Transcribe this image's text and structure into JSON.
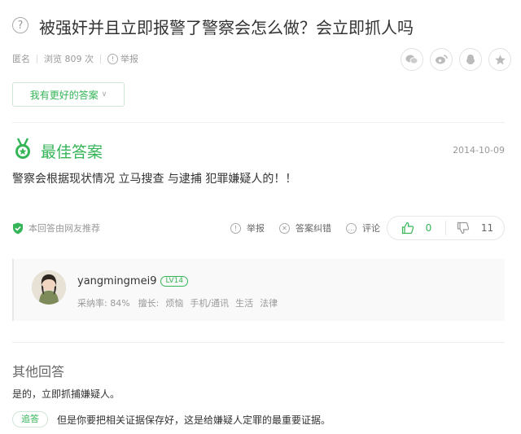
{
  "question": {
    "icon": "question-circle-icon",
    "title": "被强奸并且立即报警了警察会怎么做？会立即抓人吗",
    "meta": {
      "author": "匿名",
      "views": "浏览 809 次",
      "report": "举报"
    },
    "share_icons": [
      "wechat-icon",
      "weibo-icon",
      "qq-icon",
      "favorite-icon"
    ],
    "better_answer_button": "我有更好的答案"
  },
  "best_answer": {
    "label": "最佳答案",
    "date": "2014-10-09",
    "content": "警察会根据现状情况  立马搜查 与逮捕 犯罪嫌疑人的！！",
    "recommend_text": "本回答由网友推荐",
    "actions": {
      "report": "举报",
      "correct": "答案纠错",
      "comment": "评论"
    },
    "votes": {
      "up": "0",
      "down": "11"
    }
  },
  "author": {
    "name": "yangmingmei9",
    "level": "LV14",
    "adoption_rate_label": "采纳率:",
    "adoption_rate": "84%",
    "expertise_label": "擅长:",
    "expertise": [
      "烦恼",
      "手机/通讯",
      "生活",
      "法律"
    ]
  },
  "other_answers": {
    "title": "其他回答",
    "answer": "是的，立即抓捕嫌疑人。",
    "followup_label": "追答",
    "followup_text": "但是你要把相关证据保存好，这是给嫌疑人定罪的最重要证据。"
  },
  "colors": {
    "accent": "#35b558",
    "muted": "#999999",
    "text": "#333333"
  }
}
